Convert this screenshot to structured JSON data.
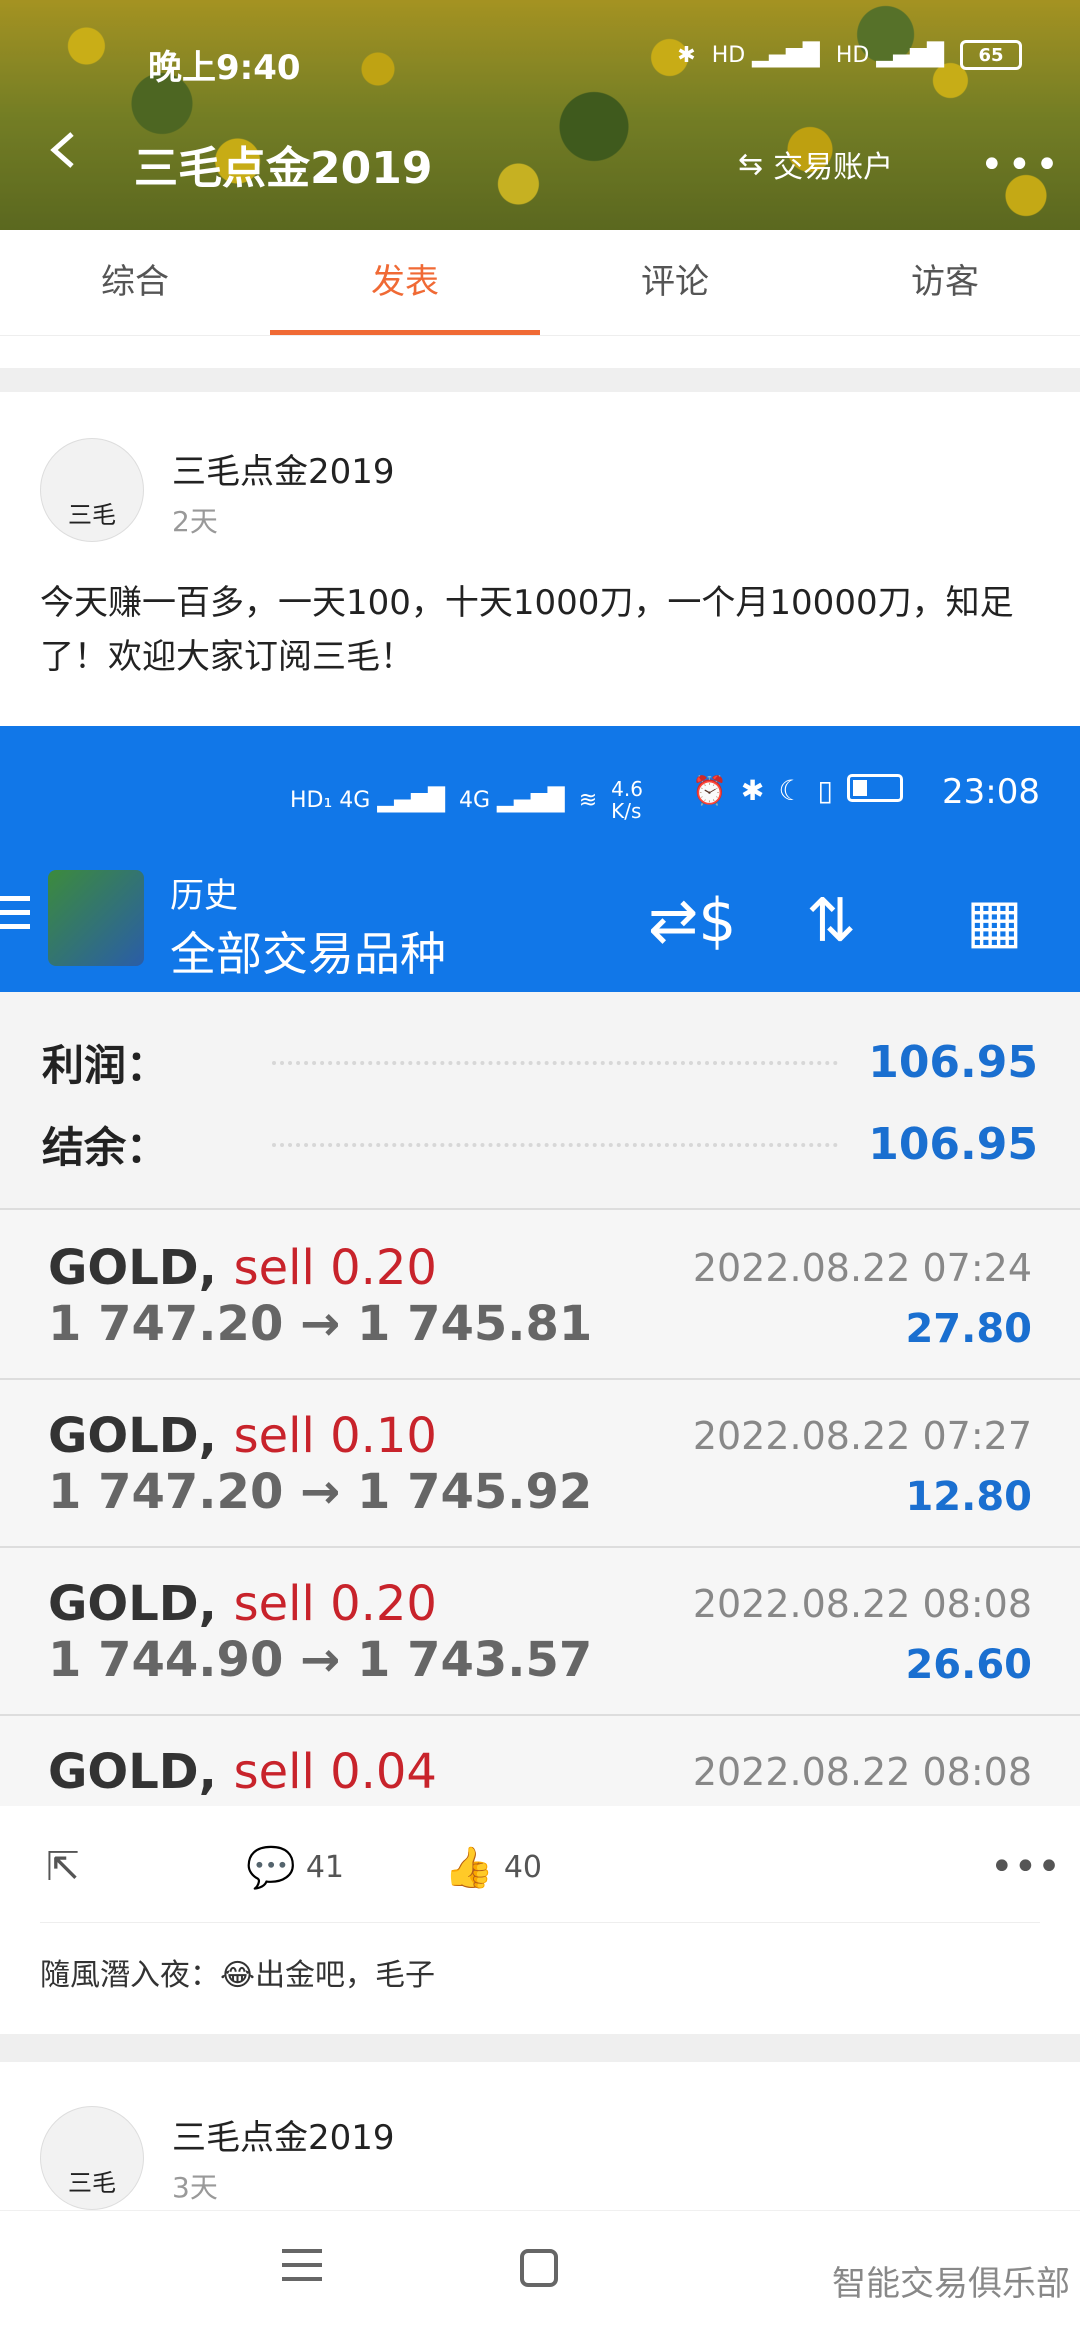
{
  "status": {
    "time": "晚上9:40",
    "battery": "65"
  },
  "header": {
    "title": "三毛点金2019",
    "account_label": "交易账户"
  },
  "tabs": [
    {
      "label": "综合"
    },
    {
      "label": "发表"
    },
    {
      "label": "评论"
    },
    {
      "label": "访客"
    }
  ],
  "post": {
    "author": "三毛点金2019",
    "time": "2天",
    "text": "今天赚一百多，一天100，十天1000刀，一个月10000刀，知足了！欢迎大家订阅三毛！",
    "avatar_text": "三毛",
    "embedded": {
      "status_speed": "4.6\nK/s",
      "status_time": "23:08",
      "screen_title": "历史",
      "screen_subtitle": "全部交易品种",
      "summary": [
        {
          "label": "利润：",
          "value": "106.95"
        },
        {
          "label": "结余：",
          "value": "106.95"
        }
      ],
      "trades": [
        {
          "symbol": "GOLD,",
          "side": "sell 0.20",
          "price": "1 747.20 → 1 745.81",
          "date": "2022.08.22 07:24",
          "profit": "27.80"
        },
        {
          "symbol": "GOLD,",
          "side": "sell 0.10",
          "price": "1 747.20 → 1 745.92",
          "date": "2022.08.22 07:27",
          "profit": "12.80"
        },
        {
          "symbol": "GOLD,",
          "side": "sell 0.20",
          "price": "1 744.90 → 1 743.57",
          "date": "2022.08.22 08:08",
          "profit": "26.60"
        },
        {
          "symbol": "GOLD,",
          "side": "sell 0.04",
          "price": "",
          "date": "2022.08.22 08:08",
          "profit": ""
        }
      ]
    },
    "comments_count": "41",
    "likes_count": "40",
    "top_comment": {
      "user": "隨風潛入夜：",
      "emoji": "😂",
      "text": "出金吧，毛子"
    }
  },
  "post2": {
    "author": "三毛点金2019",
    "time": "3天",
    "avatar_text": "三毛"
  },
  "watermark": "智能交易俱乐部"
}
